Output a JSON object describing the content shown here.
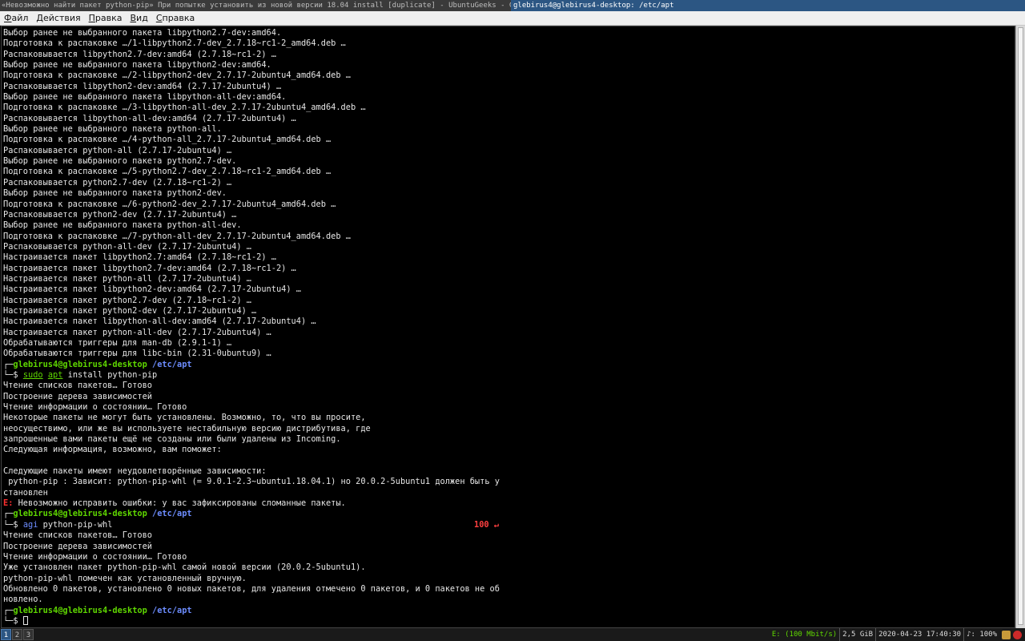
{
  "window_titles": {
    "inactive": "«Невозможно найти пакет python-pip» При попытке установить из новой версии 18.04 install [duplicate] - UbuntuGeeks - G…",
    "active": "glebirus4@glebirus4-desktop: /etc/apt"
  },
  "menu": [
    {
      "mn": "Ф",
      "rest": "айл"
    },
    {
      "mn": "Д",
      "rest": "ействия"
    },
    {
      "mn": "П",
      "rest": "равка"
    },
    {
      "mn": "В",
      "rest": "ид"
    },
    {
      "mn": "С",
      "rest": "правка"
    }
  ],
  "prompt": {
    "user_host": "glebirus4@glebirus4-desktop",
    "path": "/etc/apt"
  },
  "output_block1": [
    "Выбор ранее не выбранного пакета libpython2.7-dev:amd64.",
    "Подготовка к распаковке …/1-libpython2.7-dev_2.7.18~rc1-2_amd64.deb …",
    "Распаковывается libpython2.7-dev:amd64 (2.7.18~rc1-2) …",
    "Выбор ранее не выбранного пакета libpython2-dev:amd64.",
    "Подготовка к распаковке …/2-libpython2-dev_2.7.17-2ubuntu4_amd64.deb …",
    "Распаковывается libpython2-dev:amd64 (2.7.17-2ubuntu4) …",
    "Выбор ранее не выбранного пакета libpython-all-dev:amd64.",
    "Подготовка к распаковке …/3-libpython-all-dev_2.7.17-2ubuntu4_amd64.deb …",
    "Распаковывается libpython-all-dev:amd64 (2.7.17-2ubuntu4) …",
    "Выбор ранее не выбранного пакета python-all.",
    "Подготовка к распаковке …/4-python-all_2.7.17-2ubuntu4_amd64.deb …",
    "Распаковывается python-all (2.7.17-2ubuntu4) …",
    "Выбор ранее не выбранного пакета python2.7-dev.",
    "Подготовка к распаковке …/5-python2.7-dev_2.7.18~rc1-2_amd64.deb …",
    "Распаковывается python2.7-dev (2.7.18~rc1-2) …",
    "Выбор ранее не выбранного пакета python2-dev.",
    "Подготовка к распаковке …/6-python2-dev_2.7.17-2ubuntu4_amd64.deb …",
    "Распаковывается python2-dev (2.7.17-2ubuntu4) …",
    "Выбор ранее не выбранного пакета python-all-dev.",
    "Подготовка к распаковке …/7-python-all-dev_2.7.17-2ubuntu4_amd64.deb …",
    "Распаковывается python-all-dev (2.7.17-2ubuntu4) …",
    "Настраивается пакет libpython2.7:amd64 (2.7.18~rc1-2) …",
    "Настраивается пакет libpython2.7-dev:amd64 (2.7.18~rc1-2) …",
    "Настраивается пакет python-all (2.7.17-2ubuntu4) …",
    "Настраивается пакет libpython2-dev:amd64 (2.7.17-2ubuntu4) …",
    "Настраивается пакет python2.7-dev (2.7.18~rc1-2) …",
    "Настраивается пакет python2-dev (2.7.17-2ubuntu4) …",
    "Настраивается пакет libpython-all-dev:amd64 (2.7.17-2ubuntu4) …",
    "Настраивается пакет python-all-dev (2.7.17-2ubuntu4) …",
    "Обрабатываются триггеры для man-db (2.9.1-1) …",
    "Обрабатываются триггеры для libc-bin (2.31-0ubuntu9) …"
  ],
  "cmd1": {
    "part1": "sudo",
    "part2": "apt",
    "rest": " install python-pip"
  },
  "output_block2": [
    "Чтение списков пакетов… Готово",
    "Построение дерева зависимостей",
    "Чтение информации о состоянии… Готово",
    "Некоторые пакеты не могут быть установлены. Возможно, то, что вы просите,",
    "неосуществимо, или же вы используете нестабильную версию дистрибутива, где",
    "запрошенные вами пакеты ещё не созданы или были удалены из Incoming.",
    "Следующая информация, возможно, вам поможет:",
    "",
    "Следующие пакеты имеют неудовлетворённые зависимости:",
    " python-pip : Зависит: python-pip-whl (= 9.0.1-2.3~ubuntu1.18.04.1) но 20.0.2-5ubuntu1 должен быть у",
    "становлен"
  ],
  "error_line": {
    "prefix": "E:",
    "text": " Невозможно исправить ошибки: у вас зафиксированы сломанные пакеты."
  },
  "cmd2": {
    "part1": "agi",
    "rest": " python-pip-whl",
    "status": "100 ↵"
  },
  "output_block3": [
    "Чтение списков пакетов… Готово",
    "Построение дерева зависимостей",
    "Чтение информации о состоянии… Готово",
    "Уже установлен пакет python-pip-whl самой новой версии (20.0.2-5ubuntu1).",
    "python-pip-whl помечен как установленный вручную.",
    "Обновлено 0 пакетов, установлено 0 новых пакетов, для удаления отмечено 0 пакетов, и 0 пакетов не об",
    "новлено."
  ],
  "frame": {
    "top": "┌─",
    "bottom": "└─",
    "dollar": "$ "
  },
  "statusbar": {
    "workspaces": [
      "1",
      "2",
      "3"
    ],
    "network": "E: (100 Mbit/s)",
    "memory": "2,5 GiB",
    "datetime": "2020-04-23 17:40:30",
    "volume": "♪: 100%"
  }
}
